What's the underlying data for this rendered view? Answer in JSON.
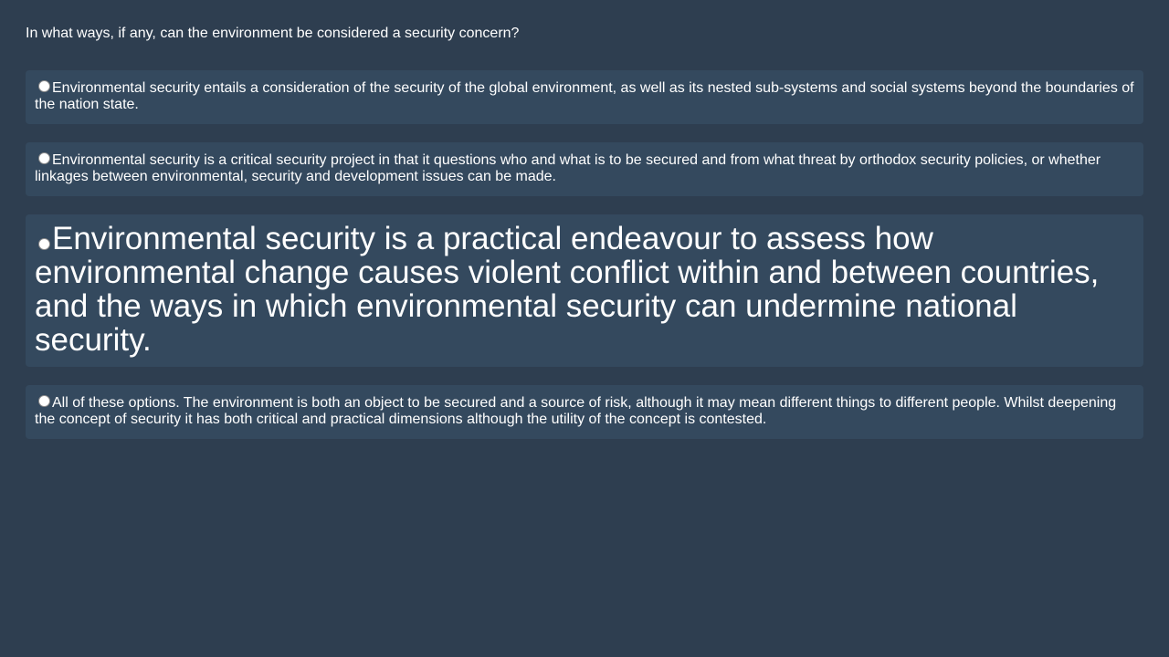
{
  "question": "In what ways, if any, can the environment be considered a security concern?",
  "options": [
    {
      "label": "Environmental security entails a consideration of the security of the global environment, as well as its nested sub-systems and social systems beyond the boundaries of the nation state."
    },
    {
      "label": "Environmental security is a critical security project in that it questions who and what is to be secured and from what threat by orthodox security policies, or whether linkages between environmental, security and development issues can be made."
    },
    {
      "label": "Environmental security is a practical endeavour to assess how environmental change causes violent conflict within and between countries, and the ways in which environmental security can undermine national security."
    },
    {
      "label": "All of these options. The environment is both an object to be secured and a source of risk, although it may mean different things to different people. Whilst deepening the concept of security it has both critical and practical dimensions although the utility of the concept is contested."
    }
  ],
  "colors": {
    "background": "#2e3e50",
    "option_background": "#34495e",
    "text": "#ffffff"
  }
}
